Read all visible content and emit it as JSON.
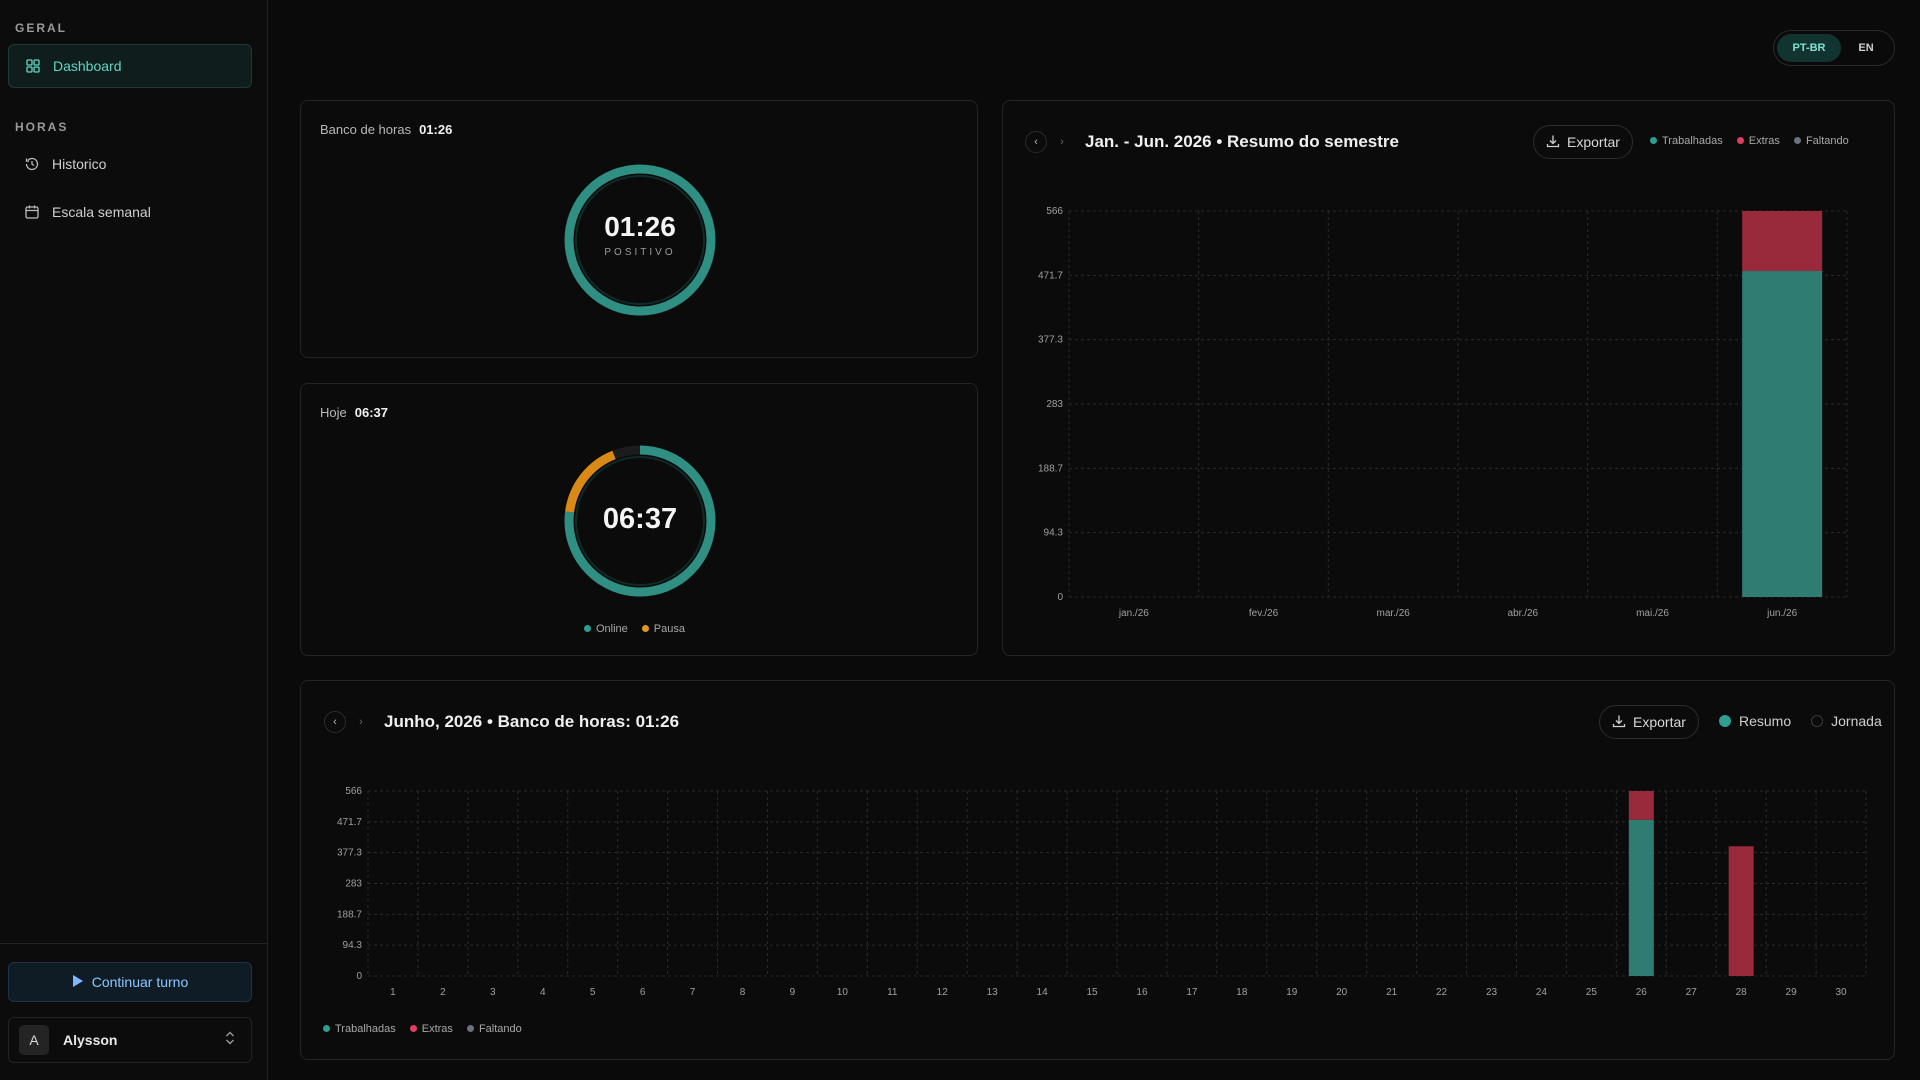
{
  "sidebar": {
    "section_general": "GERAL",
    "section_hours": "HORAS",
    "items": [
      {
        "label": "Dashboard",
        "icon": "grid-icon",
        "active": true
      },
      {
        "label": "Historico",
        "icon": "history-icon",
        "active": false
      },
      {
        "label": "Escala semanal",
        "icon": "calendar-icon",
        "active": false
      }
    ],
    "continue_label": "Continuar turno",
    "user_initial": "A",
    "user_name": "Alysson"
  },
  "lang": {
    "active": "PT-BR",
    "other": "EN"
  },
  "bank_card": {
    "title": "Banco de horas",
    "value": "01:26",
    "ring_value": "01:26",
    "ring_label": "POSITIVO"
  },
  "today_card": {
    "title": "Hoje",
    "value": "06:37",
    "ring_value": "06:37",
    "online_fraction": 0.77,
    "pause_fraction": 0.17,
    "legend": [
      {
        "label": "Online",
        "color": "#2e9e8e"
      },
      {
        "label": "Pausa",
        "color": "#e09a1a"
      }
    ]
  },
  "semester_chart": {
    "title": "Jan. - Jun. 2026 • Resumo do semestre",
    "export_label": "Exportar",
    "legend": [
      {
        "label": "Trabalhadas",
        "color": "#2e9e8e"
      },
      {
        "label": "Extras",
        "color": "#e04060"
      },
      {
        "label": "Faltando",
        "color": "#6b7280"
      }
    ]
  },
  "month_chart": {
    "title": "Junho, 2026 • Banco de horas: 01:26",
    "export_label": "Exportar",
    "radio_options": [
      {
        "label": "Resumo",
        "selected": true
      },
      {
        "label": "Jornada",
        "selected": false
      }
    ],
    "legend": [
      {
        "label": "Trabalhadas",
        "color": "#2e9e8e"
      },
      {
        "label": "Extras",
        "color": "#e04060"
      },
      {
        "label": "Faltando",
        "color": "#6b7280"
      }
    ]
  },
  "chart_data": [
    {
      "type": "bar",
      "stacked": true,
      "title": "Jan. - Jun. 2026 • Resumo do semestre",
      "categories": [
        "jan./26",
        "fev./26",
        "mar./26",
        "abr./26",
        "mai./26",
        "jun./26"
      ],
      "series": [
        {
          "name": "Trabalhadas",
          "color": "#2e7c72",
          "values": [
            0,
            0,
            0,
            0,
            0,
            478
          ]
        },
        {
          "name": "Extras",
          "color": "#982a3c",
          "values": [
            0,
            0,
            0,
            0,
            0,
            88
          ]
        },
        {
          "name": "Faltando",
          "color": "#4b5563",
          "values": [
            0,
            0,
            0,
            0,
            0,
            0
          ]
        }
      ],
      "yticks": [
        "0",
        "94.3",
        "188.7",
        "283",
        "377.3",
        "471.7",
        "566"
      ],
      "ylim": [
        0,
        566
      ],
      "grid": true
    },
    {
      "type": "bar",
      "stacked": true,
      "title": "Junho, 2026 • Banco de horas: 01:26",
      "categories": [
        "1",
        "2",
        "3",
        "4",
        "5",
        "6",
        "7",
        "8",
        "9",
        "10",
        "11",
        "12",
        "13",
        "14",
        "15",
        "16",
        "17",
        "18",
        "19",
        "20",
        "21",
        "22",
        "23",
        "24",
        "25",
        "26",
        "27",
        "28",
        "29",
        "30"
      ],
      "series": [
        {
          "name": "Trabalhadas",
          "color": "#2e7c72",
          "values": [
            0,
            0,
            0,
            0,
            0,
            0,
            0,
            0,
            0,
            0,
            0,
            0,
            0,
            0,
            0,
            0,
            0,
            0,
            0,
            0,
            0,
            0,
            0,
            0,
            0,
            478,
            0,
            0,
            0,
            0
          ]
        },
        {
          "name": "Extras",
          "color": "#982a3c",
          "values": [
            0,
            0,
            0,
            0,
            0,
            0,
            0,
            0,
            0,
            0,
            0,
            0,
            0,
            0,
            0,
            0,
            0,
            0,
            0,
            0,
            0,
            0,
            0,
            0,
            0,
            88,
            0,
            397,
            0,
            0
          ]
        },
        {
          "name": "Faltando",
          "color": "#4b5563",
          "values": [
            0,
            0,
            0,
            0,
            0,
            0,
            0,
            0,
            0,
            0,
            0,
            0,
            0,
            0,
            0,
            0,
            0,
            0,
            0,
            0,
            0,
            0,
            0,
            0,
            0,
            0,
            0,
            0,
            0,
            0
          ]
        }
      ],
      "yticks": [
        "0",
        "94.3",
        "188.7",
        "283",
        "377.3",
        "471.7",
        "566"
      ],
      "ylim": [
        0,
        566
      ],
      "grid": true
    }
  ]
}
